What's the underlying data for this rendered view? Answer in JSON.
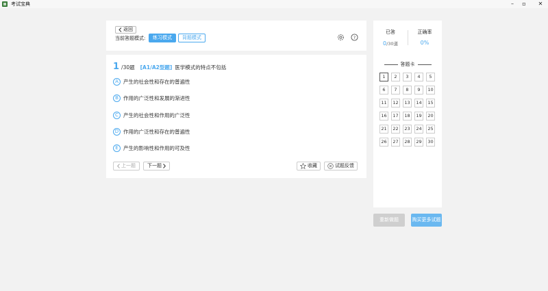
{
  "window": {
    "title": "考试宝典",
    "icon": "app-logo-icon",
    "controls": [
      "minimize-icon",
      "maximize-icon",
      "close-icon"
    ]
  },
  "toolbar": {
    "back_label": "返回",
    "mode_label": "当前答题模式:",
    "practice_mode": "练习模式",
    "memorize_mode": "背题模式",
    "settings_icon": "gear-icon",
    "help_icon": "help-icon"
  },
  "question": {
    "number": "1",
    "total": "/30题",
    "type": "[A1/A2型题]",
    "text": "医学模式的特点不包括",
    "options": [
      {
        "letter": "A",
        "text": "产生的社会性和存在的普遍性"
      },
      {
        "letter": "B",
        "text": "作用的广泛性和发展的渐进性"
      },
      {
        "letter": "C",
        "text": "产生的社会性和作用的广泛性"
      },
      {
        "letter": "D",
        "text": "作用的广泛性和存在的普遍性"
      },
      {
        "letter": "E",
        "text": "产生的影响性和作用的可及性"
      }
    ],
    "prev_label": "上一题",
    "next_label": "下一题",
    "favorite_label": "收藏",
    "report_label": "试题反馈"
  },
  "answer_card": {
    "answered_label": "已答",
    "answered_count": "0",
    "answered_suffix": "/30道",
    "accuracy_label": "正确率",
    "accuracy_value": "0%",
    "title": "答题卡",
    "numbers": [
      "1",
      "2",
      "3",
      "4",
      "5",
      "6",
      "7",
      "8",
      "9",
      "10",
      "11",
      "12",
      "13",
      "14",
      "15",
      "16",
      "17",
      "18",
      "19",
      "20",
      "21",
      "22",
      "23",
      "24",
      "25",
      "26",
      "27",
      "28",
      "29",
      "30"
    ]
  },
  "footer": {
    "reset_label": "重新做题",
    "buy_label": "购买更多试题"
  },
  "colors": {
    "accent": "#4aa8ee",
    "background": "#f2f2f2",
    "disabled": "#cfcfcf"
  }
}
